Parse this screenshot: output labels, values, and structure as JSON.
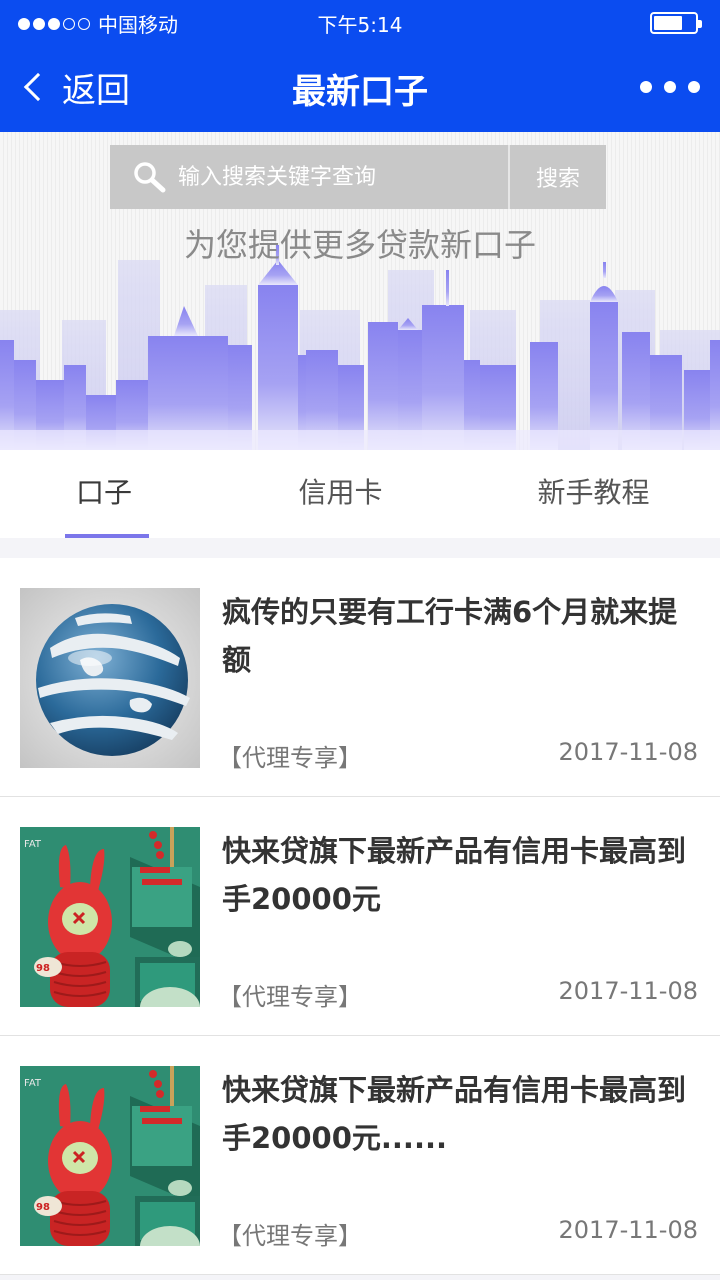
{
  "status": {
    "carrier": "中国移动",
    "time": "下午5:14",
    "battery_level": 0.7,
    "signal_bars_filled": 3,
    "signal_bars_total": 5
  },
  "nav": {
    "back_label": "返回",
    "title": "最新口子"
  },
  "search": {
    "placeholder": "输入搜索关键字查询",
    "button_label": "搜索"
  },
  "banner": {
    "slogan": "为您提供更多贷款新口子"
  },
  "tabs": [
    {
      "label": "口子",
      "active": true
    },
    {
      "label": "信用卡",
      "active": false
    },
    {
      "label": "新手教程",
      "active": false
    }
  ],
  "articles": [
    {
      "title": "疯传的只要有工行卡满6个月就来提额",
      "tag": "【代理专享】",
      "date": "2017-11-08",
      "thumb": "globe"
    },
    {
      "title": "快来贷旗下最新产品有信用卡最高到手20000元",
      "tag": "【代理专享】",
      "date": "2017-11-08",
      "thumb": "red-rabbit"
    },
    {
      "title": "快来贷旗下最新产品有信用卡最高到手20000元......",
      "tag": "【代理专享】",
      "date": "2017-11-08",
      "thumb": "red-rabbit"
    }
  ],
  "colors": {
    "header": "#0b4cf0",
    "accent": "#7b76ea",
    "skyline": "#8f8af0"
  }
}
